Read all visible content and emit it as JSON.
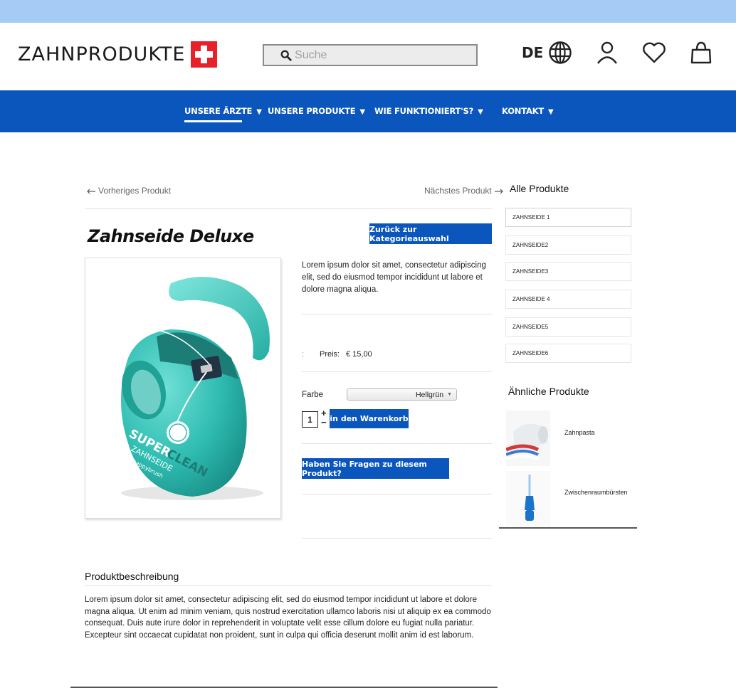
{
  "header": {
    "logo_text": "ZAHNPRODUKTE",
    "search_placeholder": "Suche",
    "language": "DE"
  },
  "nav": {
    "items": [
      {
        "label": "UNSERE ÄRZTE",
        "active": true
      },
      {
        "label": "UNSERE PRODUKTE",
        "active": false
      },
      {
        "label": "WIE FUNKTIONIERT'S?",
        "active": false
      },
      {
        "label": "KONTAKT",
        "active": false
      }
    ],
    "caret": "▼"
  },
  "pager": {
    "previous": "Vorheriges Produkt",
    "next": "Nächstes Produkt"
  },
  "product": {
    "title": "Zahnseide Deluxe",
    "back_button": "Zurück zur Kategorieauswahl",
    "short_description": "Lorem ipsum dolor sit amet, consectetur adipiscing elit, sed do eiusmod tempor incididunt ut labore et dolore magna aliqua.",
    "price_label": "Preis:",
    "price_value": "€ 15,00",
    "color_label": "Farbe",
    "color_selected": "Hellgrün",
    "quantity": "1",
    "add_to_cart": "in den Warenkorb",
    "question_button": "Haben Sie Fragen zu diesem Produkt?",
    "image_text": {
      "brand1": "SUPER",
      "brand2": "CLEAN",
      "sub": "ZAHNSEIDE",
      "maker": "happybrush"
    }
  },
  "sidebar": {
    "all_products_title": "Alle Produkte",
    "categories": [
      "ZAHNSEIDE 1",
      "ZAHNSEIDE2",
      "ZAHNSEIDE3",
      "ZAHNSEIDE 4",
      "ZAHNSEIDE5",
      "ZAHNSEIDE6"
    ],
    "similar_title": "Ähnliche Produkte",
    "similar": [
      {
        "label": "Zahnpasta"
      },
      {
        "label": "Zwischenraumbürsten"
      }
    ]
  },
  "description": {
    "title": "Produktbeschreibung",
    "text": "Lorem ipsum dolor sit amet, consectetur adipiscing elit, sed do eiusmod tempor incididunt ut labore et dolore magna aliqua. Ut enim ad minim veniam, quis nostrud exercitation ullamco laboris nisi ut aliquip ex ea commodo consequat. Duis aute irure dolor in reprehenderit in voluptate velit esse cillum dolore eu fugiat nulla pariatur. Excepteur sint occaecat cupidatat non proident, sunt in culpa qui officia deserunt mollit anim id est laborum."
  },
  "colors": {
    "brand_blue": "#0a56bd",
    "top_strip": "#a6cbf5",
    "logo_red": "#e8202a",
    "product_teal": "#3ec9bd"
  },
  "icons": [
    "search-icon",
    "globe-icon",
    "user-icon",
    "heart-icon",
    "shopping-bag-icon",
    "arrow-left-icon",
    "arrow-right-icon"
  ]
}
